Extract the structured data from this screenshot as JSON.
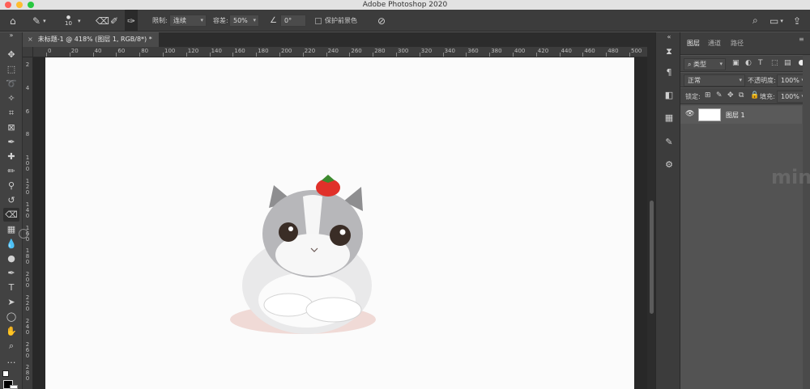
{
  "window": {
    "title": "Adobe Photoshop 2020"
  },
  "options_bar": {
    "brush_size": "10",
    "limits_label": "限制:",
    "limits_value": "连续",
    "tolerance_label": "容差:",
    "tolerance_value": "50%",
    "angle_value": "0°",
    "protect_fg_label": "保护前景色"
  },
  "document": {
    "tab_title": "未标题-1 @ 418% (图层 1, RGB/8*) *"
  },
  "ruler_top": [
    "0",
    "20",
    "40",
    "60",
    "80",
    "100",
    "120",
    "140",
    "160",
    "180",
    "200",
    "220",
    "240",
    "260",
    "280",
    "300",
    "320",
    "340",
    "360",
    "380",
    "400",
    "420",
    "440",
    "460",
    "480",
    "500"
  ],
  "ruler_left": [
    "2",
    "4",
    "6",
    "8",
    "1 0 0",
    "1 2 0",
    "1 4 0",
    "1 6 0",
    "1 8 0",
    "2 0 0",
    "2 2 0",
    "2 4 0",
    "2 6 0",
    "2 8 0"
  ],
  "layers_panel": {
    "tabs": [
      "图层",
      "通道",
      "路径"
    ],
    "filter_kind": "类型",
    "blend_mode": "正常",
    "opacity_label": "不透明度:",
    "opacity_value": "100%",
    "lock_label": "锁定:",
    "fill_label": "填充:",
    "fill_value": "100%",
    "layers": [
      {
        "name": "图层 1",
        "visible": true
      }
    ]
  },
  "watermark": "min",
  "colors": {
    "titlebar": "#e2e2e2",
    "panel": "#535353",
    "toolbar": "#424242",
    "canvas": "#fbfbfb"
  }
}
